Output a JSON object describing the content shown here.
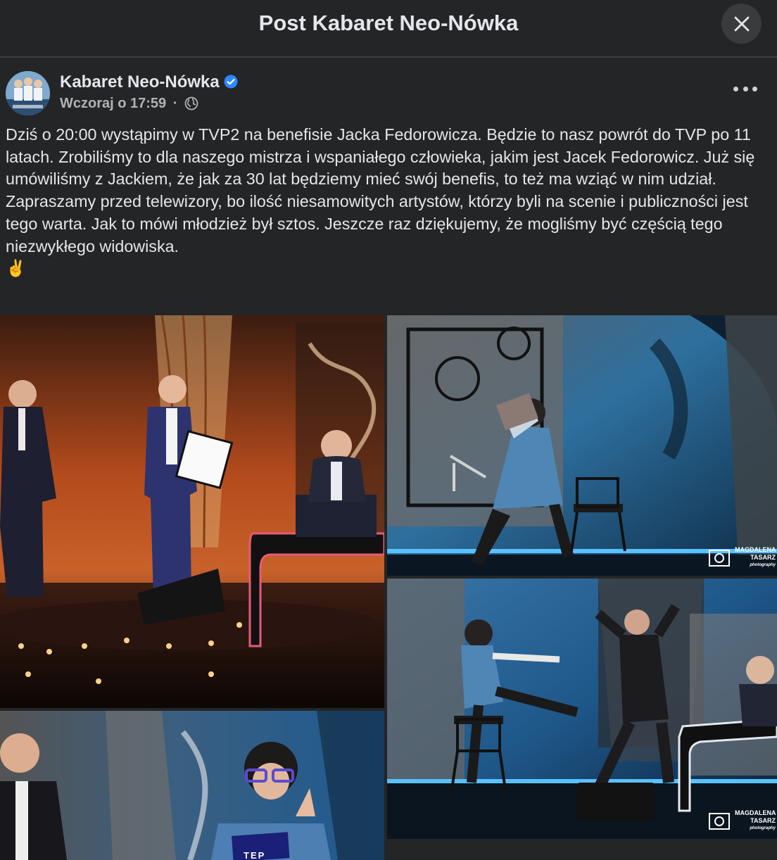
{
  "topbar": {
    "title": "Post Kabaret Neo-Nówka",
    "close_icon": "close-icon"
  },
  "post": {
    "author": "Kabaret Neo-Nówka",
    "verified_icon": "verified-badge-icon",
    "timestamp": "Wczoraj o 17:59",
    "separator": "·",
    "audience_icon": "globe-icon",
    "more_icon": "more-options-icon",
    "text_lines": [
      "Dziś o 20:00 wystąpimy w TVP2 na benefisie Jacka Fedorowicza. Będzie to nasz powrót do TVP po 11 latach. Zrobiliśmy to dla naszego mistrza i wspaniałego człowieka, jakim jest Jacek Fedorowicz. Już się umówiliśmy z Jackiem, że jak za 30 lat będziemy mieć swój benefis, to też ma wziąć w nim udział.",
      "Zapraszamy przed telewizory, bo ilość niesamowitych artystów, którzy byli na scenie i publiczności jest tego warta. Jak to mówi młodzież był sztos. Jeszcze raz dziękujemy, że mogliśmy być częścią tego niezwykłego widowiska.",
      "✌️"
    ],
    "photos": [
      {
        "name": "photo-1",
        "watermark": ""
      },
      {
        "name": "photo-2",
        "watermark": "MAGDALENA TASARZ"
      },
      {
        "name": "photo-3",
        "watermark": "MAGDALENA TASARZ"
      },
      {
        "name": "photo-4",
        "watermark": ""
      }
    ],
    "watermark_sub": "photography",
    "photo4_card_text": "TEP"
  }
}
